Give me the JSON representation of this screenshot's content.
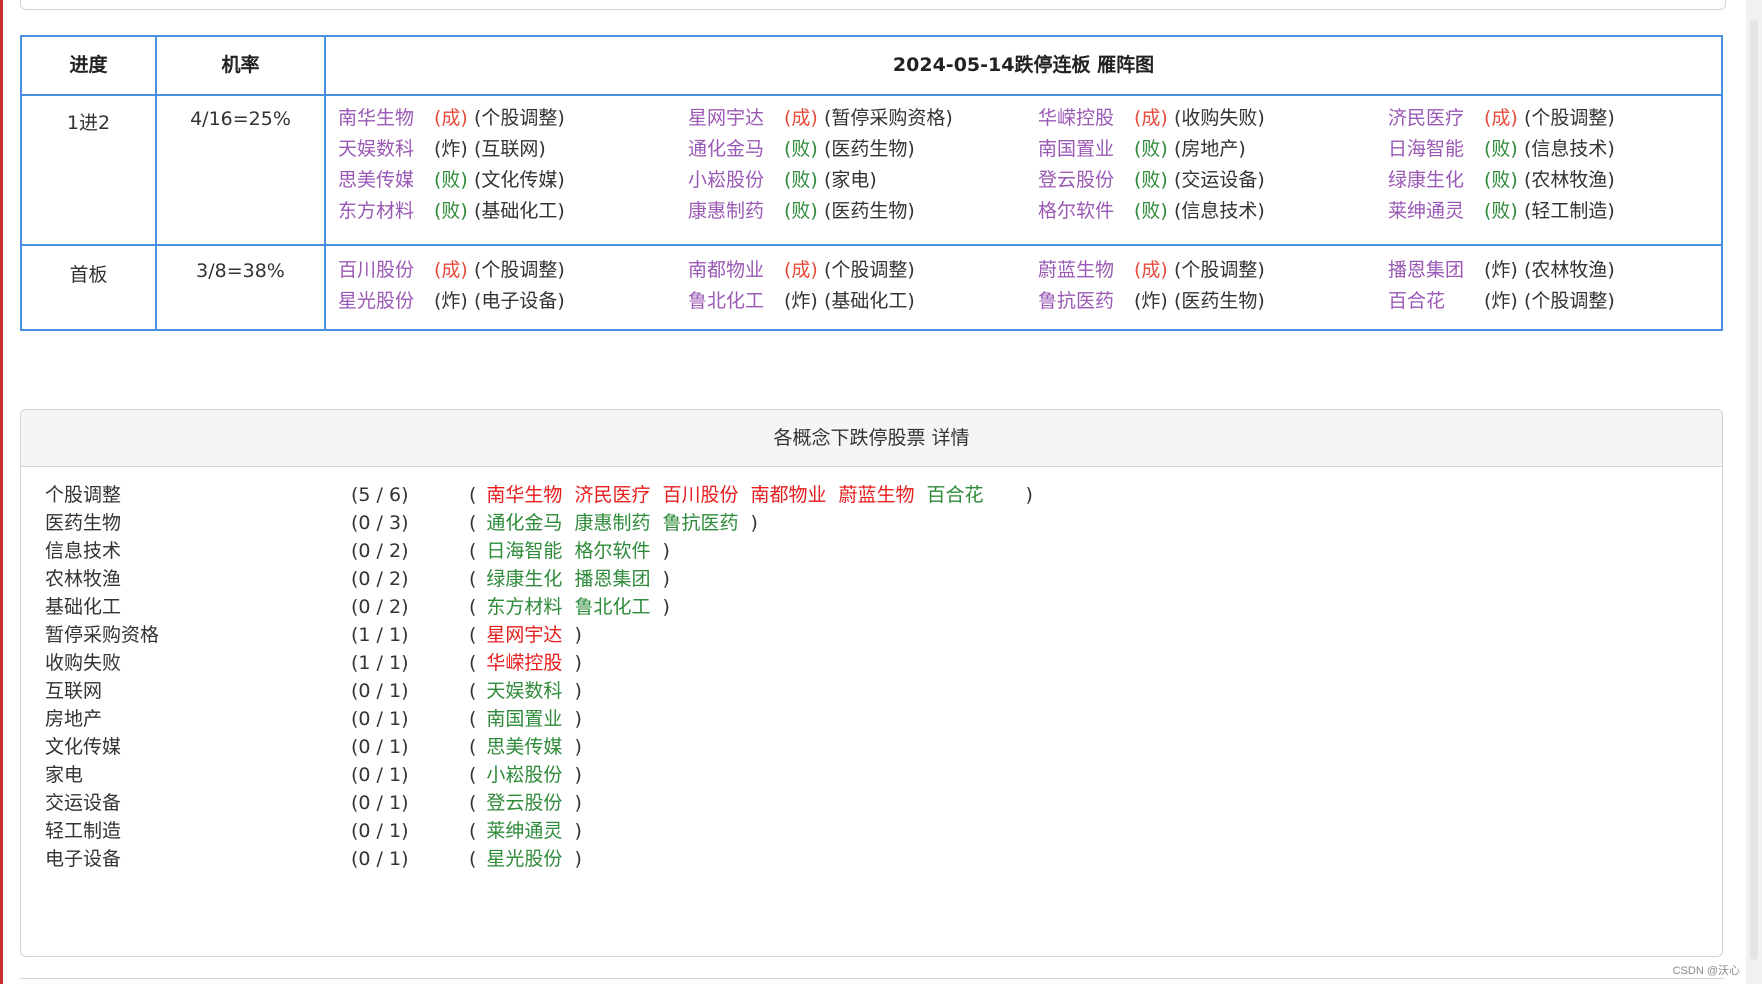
{
  "ladder": {
    "headers": {
      "progress": "进度",
      "rate": "机率",
      "title": "2024-05-14跌停连板 雁阵图"
    },
    "rows": [
      {
        "progress": "1进2",
        "rate": "4/16=25%",
        "stocks": [
          {
            "name": "南华生物",
            "status": "(成)",
            "status_type": "success",
            "concept": "(个股调整)"
          },
          {
            "name": "星网宇达",
            "status": "(成)",
            "status_type": "success",
            "concept": "(暂停采购资格)"
          },
          {
            "name": "华嵘控股",
            "status": "(成)",
            "status_type": "success",
            "concept": "(收购失败)"
          },
          {
            "name": "济民医疗",
            "status": "(成)",
            "status_type": "success",
            "concept": "(个股调整)"
          },
          {
            "name": "天娱数科",
            "status": "(炸)",
            "status_type": "boom",
            "concept": "(互联网)"
          },
          {
            "name": "通化金马",
            "status": "(败)",
            "status_type": "fail",
            "concept": "(医药生物)"
          },
          {
            "name": "南国置业",
            "status": "(败)",
            "status_type": "fail",
            "concept": "(房地产)"
          },
          {
            "name": "日海智能",
            "status": "(败)",
            "status_type": "fail",
            "concept": "(信息技术)"
          },
          {
            "name": "思美传媒",
            "status": "(败)",
            "status_type": "fail",
            "concept": "(文化传媒)"
          },
          {
            "name": "小崧股份",
            "status": "(败)",
            "status_type": "fail",
            "concept": "(家电)"
          },
          {
            "name": "登云股份",
            "status": "(败)",
            "status_type": "fail",
            "concept": "(交运设备)"
          },
          {
            "name": "绿康生化",
            "status": "(败)",
            "status_type": "fail",
            "concept": "(农林牧渔)"
          },
          {
            "name": "东方材料",
            "status": "(败)",
            "status_type": "fail",
            "concept": "(基础化工)"
          },
          {
            "name": "康惠制药",
            "status": "(败)",
            "status_type": "fail",
            "concept": "(医药生物)"
          },
          {
            "name": "格尔软件",
            "status": "(败)",
            "status_type": "fail",
            "concept": "(信息技术)"
          },
          {
            "name": "莱绅通灵",
            "status": "(败)",
            "status_type": "fail",
            "concept": "(轻工制造)"
          }
        ]
      },
      {
        "progress": "首板",
        "rate": "3/8=38%",
        "stocks": [
          {
            "name": "百川股份",
            "status": "(成)",
            "status_type": "success",
            "concept": "(个股调整)"
          },
          {
            "name": "南都物业",
            "status": "(成)",
            "status_type": "success",
            "concept": "(个股调整)"
          },
          {
            "name": "蔚蓝生物",
            "status": "(成)",
            "status_type": "success",
            "concept": "(个股调整)"
          },
          {
            "name": "播恩集团",
            "status": "(炸)",
            "status_type": "boom",
            "concept": "(农林牧渔)"
          },
          {
            "name": "星光股份",
            "status": "(炸)",
            "status_type": "boom",
            "concept": "(电子设备)"
          },
          {
            "name": "鲁北化工",
            "status": "(炸)",
            "status_type": "boom",
            "concept": "(基础化工)"
          },
          {
            "name": "鲁抗医药",
            "status": "(炸)",
            "status_type": "boom",
            "concept": "(医药生物)"
          },
          {
            "name": "百合花",
            "status": "(炸)",
            "status_type": "boom",
            "concept": "(个股调整)"
          }
        ]
      }
    ]
  },
  "details": {
    "title": "各概念下跌停股票 详情",
    "open_paren": "(",
    "close_paren": ")",
    "rows": [
      {
        "concept": "个股调整",
        "count": "(5 / 6)",
        "stocks": [
          {
            "name": "南华生物",
            "color": "red"
          },
          {
            "name": "济民医疗",
            "color": "red"
          },
          {
            "name": "百川股份",
            "color": "red"
          },
          {
            "name": "南都物业",
            "color": "red"
          },
          {
            "name": "蔚蓝生物",
            "color": "red"
          },
          {
            "name": "百合花",
            "color": "green"
          }
        ]
      },
      {
        "concept": "医药生物",
        "count": "(0 / 3)",
        "stocks": [
          {
            "name": "通化金马",
            "color": "green"
          },
          {
            "name": "康惠制药",
            "color": "green"
          },
          {
            "name": "鲁抗医药",
            "color": "green"
          }
        ]
      },
      {
        "concept": "信息技术",
        "count": "(0 / 2)",
        "stocks": [
          {
            "name": "日海智能",
            "color": "green"
          },
          {
            "name": "格尔软件",
            "color": "green"
          }
        ]
      },
      {
        "concept": "农林牧渔",
        "count": "(0 / 2)",
        "stocks": [
          {
            "name": "绿康生化",
            "color": "green"
          },
          {
            "name": "播恩集团",
            "color": "green"
          }
        ]
      },
      {
        "concept": "基础化工",
        "count": "(0 / 2)",
        "stocks": [
          {
            "name": "东方材料",
            "color": "green"
          },
          {
            "name": "鲁北化工",
            "color": "green"
          }
        ]
      },
      {
        "concept": "暂停采购资格",
        "count": "(1 / 1)",
        "stocks": [
          {
            "name": "星网宇达",
            "color": "red"
          }
        ]
      },
      {
        "concept": "收购失败",
        "count": "(1 / 1)",
        "stocks": [
          {
            "name": "华嵘控股",
            "color": "red"
          }
        ]
      },
      {
        "concept": "互联网",
        "count": "(0 / 1)",
        "stocks": [
          {
            "name": "天娱数科",
            "color": "green"
          }
        ]
      },
      {
        "concept": "房地产",
        "count": "(0 / 1)",
        "stocks": [
          {
            "name": "南国置业",
            "color": "green"
          }
        ]
      },
      {
        "concept": "文化传媒",
        "count": "(0 / 1)",
        "stocks": [
          {
            "name": "思美传媒",
            "color": "green"
          }
        ]
      },
      {
        "concept": "家电",
        "count": "(0 / 1)",
        "stocks": [
          {
            "name": "小崧股份",
            "color": "green"
          }
        ]
      },
      {
        "concept": "交运设备",
        "count": "(0 / 1)",
        "stocks": [
          {
            "name": "登云股份",
            "color": "green"
          }
        ]
      },
      {
        "concept": "轻工制造",
        "count": "(0 / 1)",
        "stocks": [
          {
            "name": "莱绅通灵",
            "color": "green"
          }
        ]
      },
      {
        "concept": "电子设备",
        "count": "(0 / 1)",
        "stocks": [
          {
            "name": "星光股份",
            "color": "green"
          }
        ]
      }
    ]
  },
  "watermark": "CSDN @沃心",
  "colors": {
    "border_blue": "#4a90e2",
    "stock_name_purple": "#9b59b6",
    "success_red": "#e74c3c",
    "fail_green": "#2e8b3a",
    "detail_red": "#e61e1e",
    "detail_green": "#2e8b3a"
  }
}
